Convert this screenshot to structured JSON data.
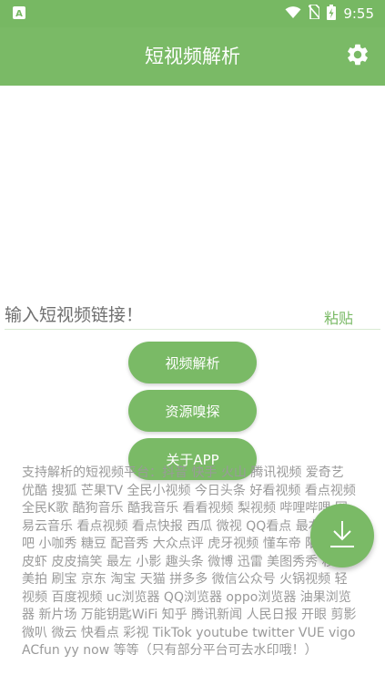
{
  "status_bar": {
    "time": "9:55",
    "app_indicator": "A",
    "icons": [
      "wifi-icon",
      "no-sim-icon",
      "battery-charging-icon"
    ]
  },
  "app_bar": {
    "title": "短视频解析",
    "settings_icon": "gear-icon"
  },
  "input": {
    "placeholder": "输入短视频链接！",
    "value": "",
    "paste_label": "粘贴"
  },
  "buttons": {
    "parse_label": "视频解析",
    "sniff_label": "资源嗅探",
    "about_label": "关于APP"
  },
  "support_text": "支持解析的短视频平台：抖音 快手 火山 腾讯视频 爱奇艺 优酷 搜狐 芒果TV 全民小视频 今日头条 好看视频 看点视频 全民K歌 酷狗音乐 酷我音乐 看看视频 梨视频 哔哩哔哩 网易云音乐 看点视频 看点快报 西瓜 微视 QQ看点 最右 皮皮吧 小咖秀 糖豆 配音秀 大众点评 虎牙视频 懂车帝 陌陌 皮皮虾 皮皮搞笑 最左 小影 趣头条 微博 迅雷 美图秀秀 秒拍 美拍 刷宝 京东 淘宝 天猫 拼多多 微信公众号 火锅视频 轻视频 百度视频 uc浏览器 QQ浏览器 oppo浏览器 油果浏览器 新片场 万能钥匙WiFi 知乎 腾讯新闻 人民日报 开眼 剪影 微叭 微云 快看点 彩视 TikTok youtube twitter VUE vigo ACfun yy now 等等（只有部分平台可去水印哦！）",
  "fab": {
    "icon": "download-icon"
  },
  "colors": {
    "primary": "#7aba66",
    "status_bar": "#77b863",
    "muted_text": "#9a9a9a"
  }
}
